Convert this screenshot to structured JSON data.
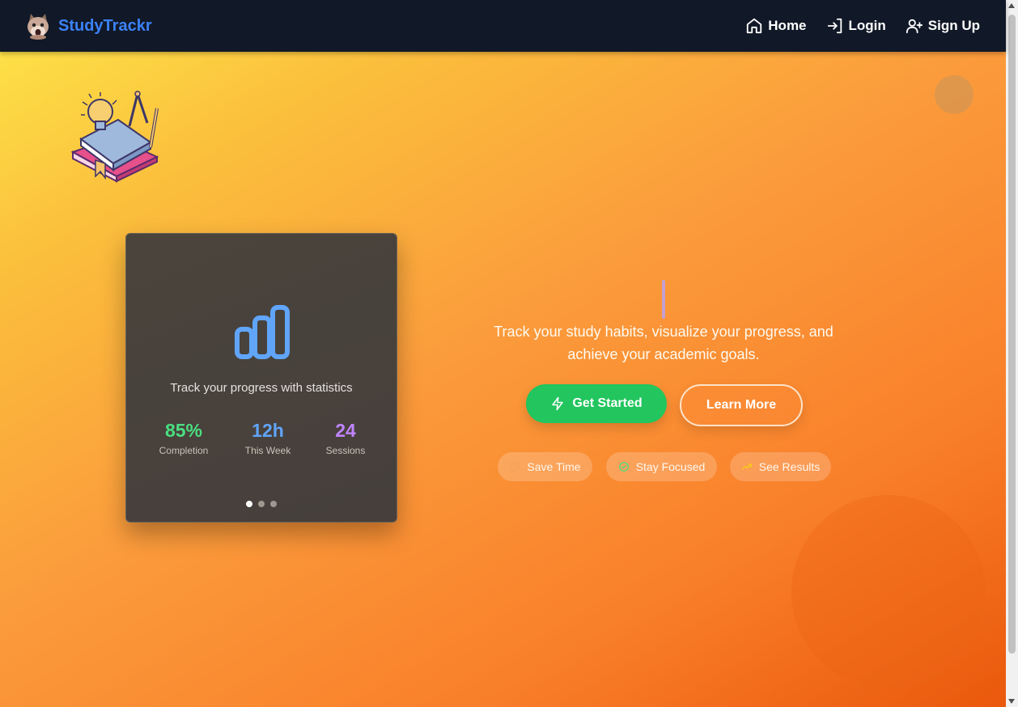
{
  "app": {
    "name": "StudyTrackr"
  },
  "nav": {
    "items": [
      {
        "label": "Home",
        "icon": "home-icon"
      },
      {
        "label": "Login",
        "icon": "login-icon"
      },
      {
        "label": "Sign Up",
        "icon": "user-plus-icon"
      }
    ]
  },
  "card": {
    "icon": "bar-chart-icon",
    "caption": "Track your progress with statistics",
    "stats": [
      {
        "value": "85%",
        "label": "Completion",
        "color": "#4ade80"
      },
      {
        "value": "12h",
        "label": "This Week",
        "color": "#60a5fa"
      },
      {
        "value": "24",
        "label": "Sessions",
        "color": "#c084fc"
      }
    ],
    "carousel": {
      "slides": 3,
      "active": 1
    }
  },
  "hero": {
    "tagline": "Track your study habits, visualize your progress, and achieve your academic goals.",
    "primary_button": "Get Started",
    "secondary_button": "Learn More",
    "features": [
      {
        "label": "Save Time",
        "icon": "clock-icon"
      },
      {
        "label": "Stay Focused",
        "icon": "check-circle-icon"
      },
      {
        "label": "See Results",
        "icon": "trending-up-icon"
      }
    ]
  },
  "colors": {
    "navbar": "#111827",
    "brand": "#3b82f6",
    "primary_button": "#22c55e",
    "gradient_start": "#fde047",
    "gradient_end": "#ea580c"
  }
}
